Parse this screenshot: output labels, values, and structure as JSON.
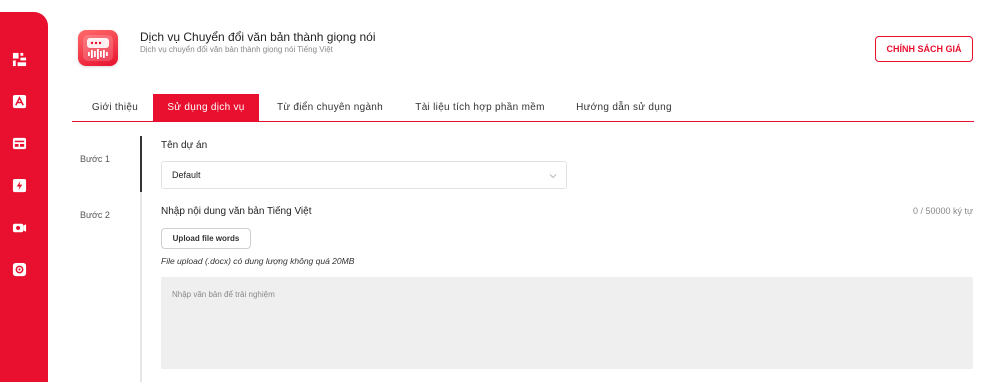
{
  "sidebar": {
    "icons": [
      "dashboard-icon",
      "text-icon",
      "card-icon",
      "lightning-icon",
      "camera-icon",
      "settings-icon"
    ]
  },
  "header": {
    "title": "Dịch vụ Chuyển đổi văn bản thành giọng nói",
    "subtitle": "Dịch vụ chuyển đổi văn bản thành giọng nói Tiếng Việt",
    "policy_button": "CHÍNH SÁCH GIÁ"
  },
  "tabs": [
    {
      "label": "Giới thiệu",
      "active": false
    },
    {
      "label": "Sử dụng dịch vụ",
      "active": true
    },
    {
      "label": "Từ điển chuyên ngành",
      "active": false
    },
    {
      "label": "Tài liệu tích hợp phần mềm",
      "active": false
    },
    {
      "label": "Hướng dẫn sử dụng",
      "active": false
    }
  ],
  "steps": {
    "step1": {
      "label": "Bước 1",
      "title": "Tên dự án",
      "select_value": "Default"
    },
    "step2": {
      "label": "Bước 2",
      "title": "Nhập nội dung văn bản Tiếng Việt",
      "char_count": "0 / 50000 ký tự",
      "upload_button": "Upload file words",
      "upload_note": "File upload (.docx) có dung lượng không quá 20MB",
      "textarea_placeholder": "Nhập văn bản để trải nghiệm"
    }
  },
  "colors": {
    "accent": "#e8102e"
  }
}
